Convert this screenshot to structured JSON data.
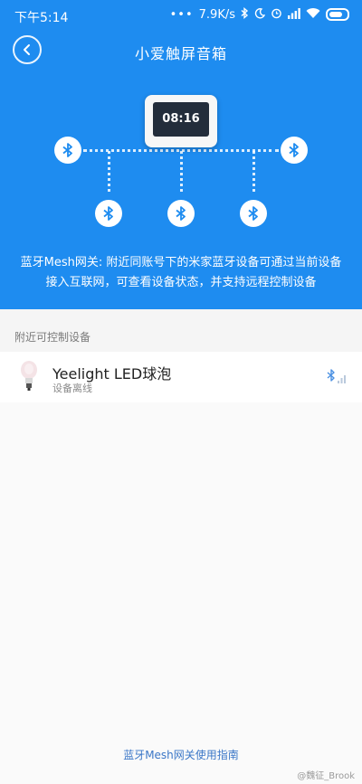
{
  "status_bar": {
    "time": "下午5:14",
    "dots": "•••",
    "speed": "7.9K/s",
    "icons": [
      "bluetooth-icon",
      "moon-icon",
      "alarm-icon",
      "signal-icon",
      "wifi-icon",
      "battery-icon"
    ]
  },
  "header": {
    "title": "小爱触屏音箱",
    "back_icon": "chevron-left-icon"
  },
  "diagram": {
    "speaker_time": "08:16",
    "node_icon": "bluetooth-icon"
  },
  "hero": {
    "description": "蓝牙Mesh网关: 附近同账号下的米家蓝牙设备可通过当前设备接入互联网，可查看设备状态，并支持远程控制设备"
  },
  "section": {
    "title": "附近可控制设备"
  },
  "devices": [
    {
      "name": "Yeelight LED球泡",
      "status": "设备离线",
      "icon": "bulb-icon",
      "signal_icon": "bluetooth-signal-icon"
    }
  ],
  "footer": {
    "guide_link": "蓝牙Mesh网关使用指南",
    "watermark": "@魏征_Brook"
  },
  "colors": {
    "primary": "#1e8cf0",
    "link": "#3b77c7"
  }
}
